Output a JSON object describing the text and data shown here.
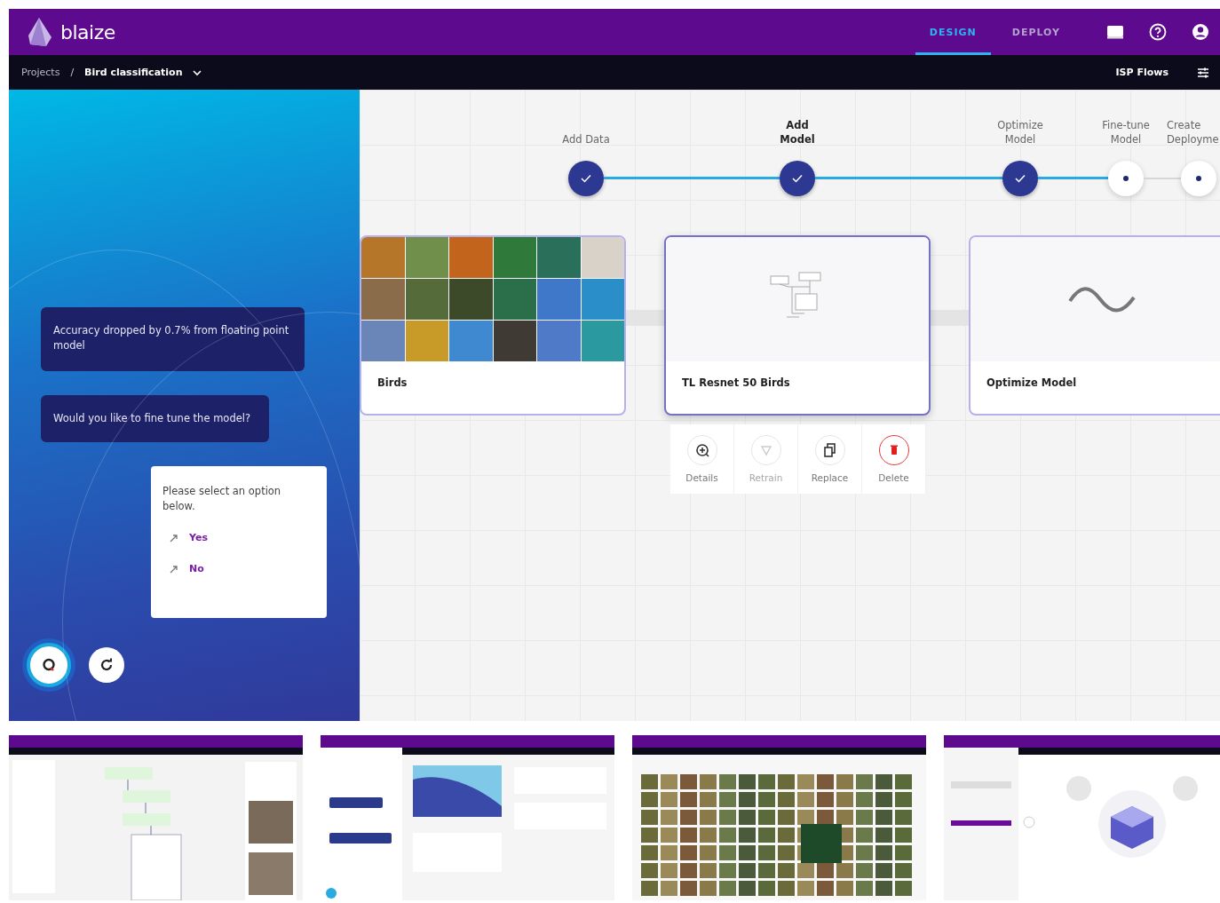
{
  "header": {
    "logo": "blaize",
    "nav_tabs": [
      {
        "label": "DESIGN",
        "selected": true
      },
      {
        "label": "DEPLOY",
        "selected": false
      }
    ]
  },
  "breadcrumb": {
    "items": [
      "Projects",
      "Bird classification"
    ],
    "separator": "/",
    "action": "ISP Flows"
  },
  "chat": {
    "messages": [
      "Accuracy dropped by 0.7% from floating point model",
      "Would you like to fine tune the model?"
    ],
    "prompt": "Please select an option below.",
    "options": [
      "Yes",
      "No"
    ]
  },
  "steps": [
    {
      "label": "Add Data",
      "done": true,
      "selected": false
    },
    {
      "label": "Add Model",
      "done": true,
      "selected": true
    },
    {
      "label": "Optimize Model",
      "done": true,
      "selected": false
    },
    {
      "label": "Fine-tune Model",
      "done": false,
      "selected": false
    },
    {
      "label": "Create Deployme",
      "done": false,
      "selected": false
    }
  ],
  "cards": [
    {
      "kind": "images",
      "title": "Birds",
      "selected": false
    },
    {
      "kind": "network",
      "title": "TL Resnet 50 Birds",
      "selected": true
    },
    {
      "kind": "wave",
      "title": "Optimize Model",
      "selected": false
    }
  ],
  "card_actions": [
    {
      "kind": "details",
      "label": "Details",
      "disabled": false
    },
    {
      "kind": "retrain",
      "label": "Retrain",
      "disabled": true
    },
    {
      "kind": "replace",
      "label": "Replace",
      "disabled": false
    },
    {
      "kind": "delete",
      "label": "Delete",
      "disabled": false
    }
  ],
  "thumbnails": [
    {
      "kind": "flow"
    },
    {
      "kind": "chat"
    },
    {
      "kind": "gallery"
    },
    {
      "kind": "deploy"
    }
  ]
}
